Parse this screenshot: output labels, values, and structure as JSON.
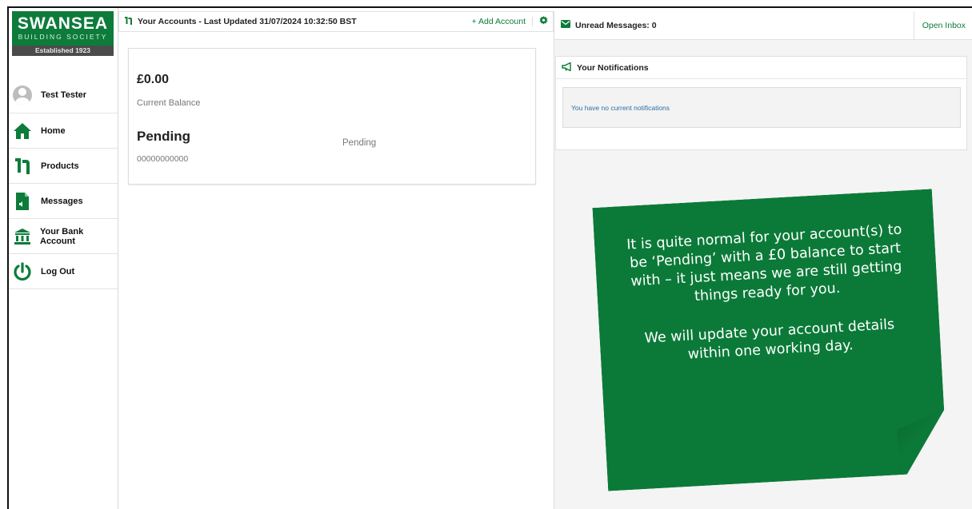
{
  "brand": {
    "name": "SWANSEA",
    "subtitle": "BUILDING SOCIETY",
    "established": "Established 1923",
    "color": "#0d7b3a"
  },
  "sidebar": {
    "user": {
      "name": "Test Tester",
      "icon": "avatar-icon"
    },
    "items": [
      {
        "label": "Home",
        "icon": "home-icon"
      },
      {
        "label": "Products",
        "icon": "products-icon"
      },
      {
        "label": "Messages",
        "icon": "messages-icon"
      },
      {
        "label": "Your Bank Account",
        "icon": "bank-icon"
      },
      {
        "label": "Log Out",
        "icon": "power-icon"
      }
    ]
  },
  "accounts": {
    "header_title": "Your Accounts - Last Updated 31/07/2024 10:32:50 BST",
    "add_label": "+ Add Account",
    "card": {
      "balance": "£0.00",
      "balance_label": "Current Balance",
      "account_name": "Pending",
      "account_number": "00000000000",
      "status": "Pending"
    }
  },
  "messages": {
    "unread_label": "Unread Messages: 0",
    "open_inbox": "Open Inbox"
  },
  "notifications": {
    "title": "Your Notifications",
    "empty_text": "You have no current notifications"
  },
  "note": {
    "paragraph1": "It is quite normal for your account(s) to be ‘Pending’ with a £0 balance to start with – it just means we are still getting things ready for you.",
    "paragraph2": "We will update your account details within one working day."
  }
}
